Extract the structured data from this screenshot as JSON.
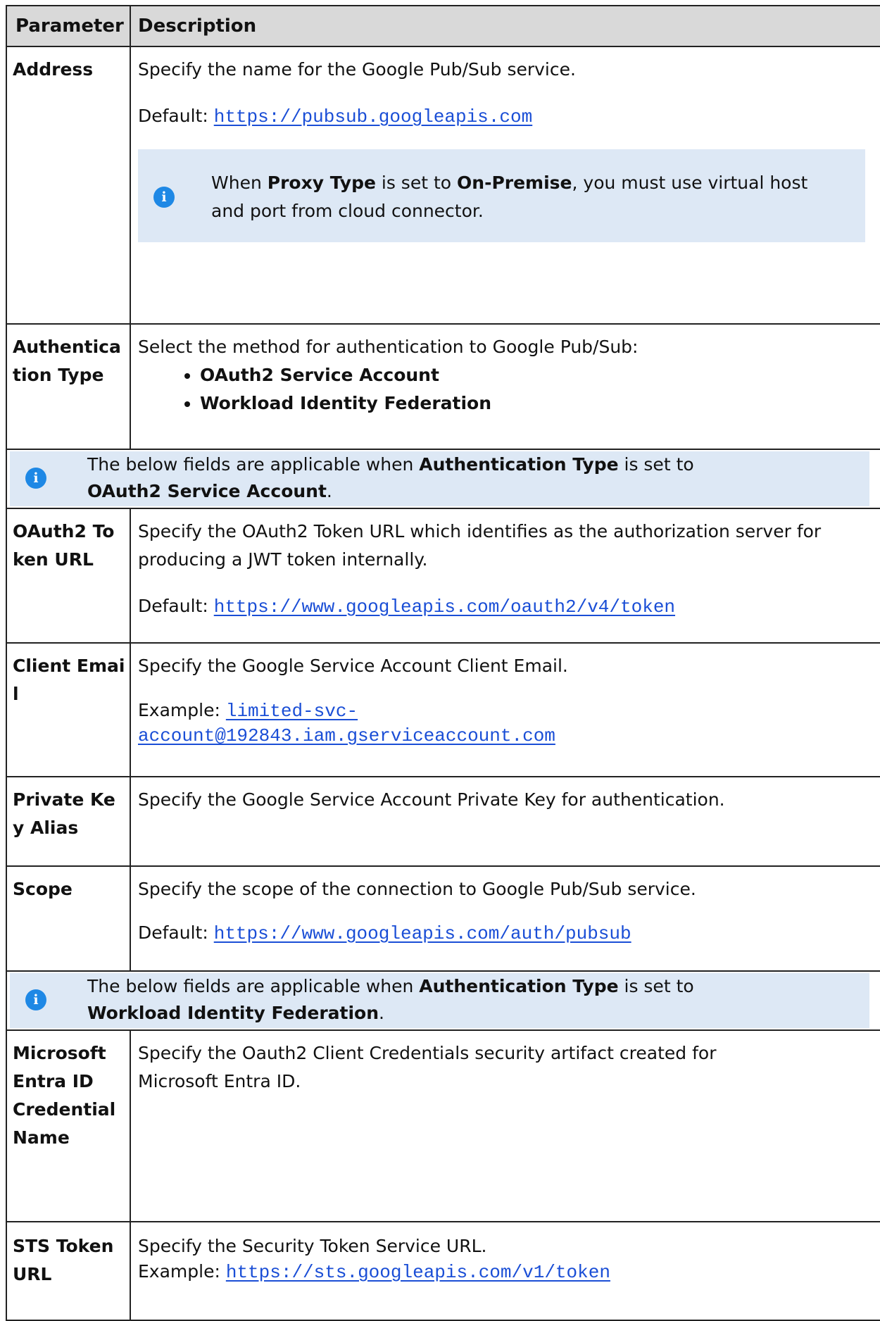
{
  "header": {
    "parameter": "Parameter",
    "description": "Description"
  },
  "address": {
    "name": "Address",
    "desc": "Specify the name for the Google Pub/Sub service.",
    "default_label": "Default: ",
    "default_value": "https://pubsub.googleapis.com",
    "note": {
      "icon": "info-icon",
      "t1": "When ",
      "b1": "Proxy Type",
      "t2": " is set to ",
      "b2": "On-Premise",
      "t3": ", you must use virtual host and port from cloud connector."
    }
  },
  "auth_type": {
    "name": "Authentication Type",
    "desc": "Select the method for authentication to Google Pub/Sub:",
    "options": [
      "OAuth2 Service Account",
      "Workload Identity Federation"
    ]
  },
  "note_oauth": {
    "t1": "The below fields are applicable when ",
    "b1": "Authentication Type",
    "t2": " is set to ",
    "b2": "OAuth2 Service Account",
    "t3": "."
  },
  "oauth_token_url": {
    "name": "OAuth2 Token URL",
    "desc": "Specify the OAuth2 Token URL which identifies as the authorization server for producing a JWT token internally.",
    "default_label": "Default: ",
    "default_value": "https://www.googleapis.com/oauth2/v4/token"
  },
  "client_email": {
    "name": "Client Email",
    "desc": "Specify the Google Service Account Client Email.",
    "example_label": "Example: ",
    "example_value_1": "limited-svc-",
    "example_value_2": "account@192843.iam.gserviceaccount.com"
  },
  "private_key": {
    "name": "Private Key Alias",
    "desc": "Specify the Google Service Account Private Key for authentication."
  },
  "scope": {
    "name": "Scope",
    "desc": "Specify the scope of the connection to Google Pub/Sub service.",
    "default_label": "Default: ",
    "default_value": "https://www.googleapis.com/auth/pubsub"
  },
  "note_wif": {
    "t1": "The below fields are applicable when ",
    "b1": "Authentication Type",
    "t2": " is set to ",
    "b2": "Workload Identity Federation",
    "t3": "."
  },
  "ms_entra": {
    "name": "Microsoft Entra ID Credential Name",
    "desc": "Specify the Oauth2 Client Credentials security artifact created for Microsoft Entra ID."
  },
  "sts_token_url": {
    "name": "STS Token URL",
    "desc": "Specify the Security Token Service URL.",
    "example_label": "Example: ",
    "example_value": "https://sts.googleapis.com/v1/token"
  },
  "colors": {
    "info_bg": "#dde8f5",
    "info_icon": "#1e88e5",
    "link": "#1a4ed6",
    "header_bg": "#d9d9d9"
  }
}
